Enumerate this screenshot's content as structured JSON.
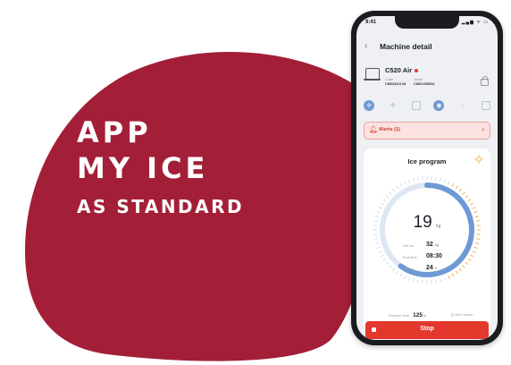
{
  "brand": {
    "blob_color": "#a31f38",
    "accent_blue": "#6e99d4",
    "stop_red": "#e3382c"
  },
  "headline": {
    "line1": "APP",
    "line2": "MY ICE",
    "line3": "AS STANDARD"
  },
  "phone": {
    "status": {
      "time": "9:41",
      "icons": "▂▄▆ ᯤ ▭"
    },
    "screen_title": "Machine detail",
    "machine": {
      "name": "C520 Air",
      "code_label": "Code",
      "code_value": "CM633321V8",
      "serial_label": "Serial",
      "serial_value": "CMD1005032"
    },
    "tool_icons": [
      "crosshair-icon",
      "move-icon",
      "grid-icon",
      "ice-program-icon",
      "search-icon",
      "list-icon"
    ],
    "alerts_label": "Alerts (1)",
    "program": {
      "title": "Ice program",
      "production_value": "19",
      "production_unit": "kg",
      "progress": 0.6,
      "set_ice_label": "Set ice",
      "set_ice_value": "32",
      "set_ice_unit": "kg",
      "end_time_label": "End time",
      "end_time_value": "08:30",
      "period_label": "Period",
      "period_value": "24",
      "period_unit": "h",
      "elapsed_label": "Elapsed time",
      "elapsed_value": "125",
      "elapsed_unit": "m",
      "next_phase_label": "Next phase"
    },
    "stop_label": "Stop"
  }
}
